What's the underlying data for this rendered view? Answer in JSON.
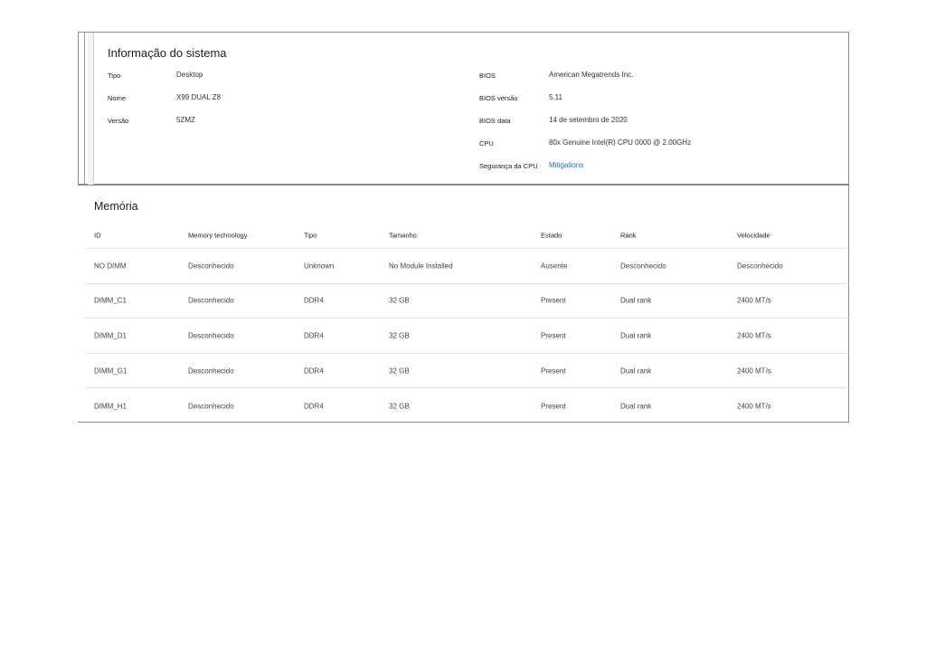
{
  "system_info": {
    "title": "Informação do sistema",
    "left": [
      {
        "label": "Tipo",
        "value": "Desktop"
      },
      {
        "label": "Nome",
        "value": "X99 DUAL Z8"
      },
      {
        "label": "Versão",
        "value": "5ZMZ"
      }
    ],
    "right": [
      {
        "label": "BIOS",
        "value": "American Megatrends Inc."
      },
      {
        "label": "BIOS versão",
        "value": "5.11"
      },
      {
        "label": "BIOS data",
        "value": "14 de setembro de 2020"
      },
      {
        "label": "CPU",
        "value": "80x Genuine Intel(R) CPU 0000 @ 2.00GHz"
      },
      {
        "label": "Segurança da CPU",
        "value": "Mitigations",
        "is_link": true
      }
    ]
  },
  "memory": {
    "title": "Memória",
    "columns": [
      "ID",
      "Memory technology",
      "Tipo",
      "Tamanho",
      "Estado",
      "Rank",
      "Velocidade"
    ],
    "rows": [
      [
        "NO DIMM",
        "Desconhecido",
        "Unknown",
        "No Module Installed",
        "Ausente",
        "Desconhecido",
        "Desconhecido"
      ],
      [
        "DIMM_C1",
        "Desconhecido",
        "DDR4",
        "32 GB",
        "Present",
        "Dual rank",
        "2400 MT/s"
      ],
      [
        "DIMM_D1",
        "Desconhecido",
        "DDR4",
        "32 GB",
        "Present",
        "Dual rank",
        "2400 MT/s"
      ],
      [
        "DIMM_G1",
        "Desconhecido",
        "DDR4",
        "32 GB",
        "Present",
        "Dual rank",
        "2400 MT/s"
      ],
      [
        "DIMM_H1",
        "Desconhecido",
        "DDR4",
        "32 GB",
        "Present",
        "Dual rank",
        "2400 MT/s"
      ]
    ]
  },
  "colors": {
    "link": "#1f6fb8",
    "border": "#8a8a8a",
    "row_divider": "#e3e3e3"
  }
}
